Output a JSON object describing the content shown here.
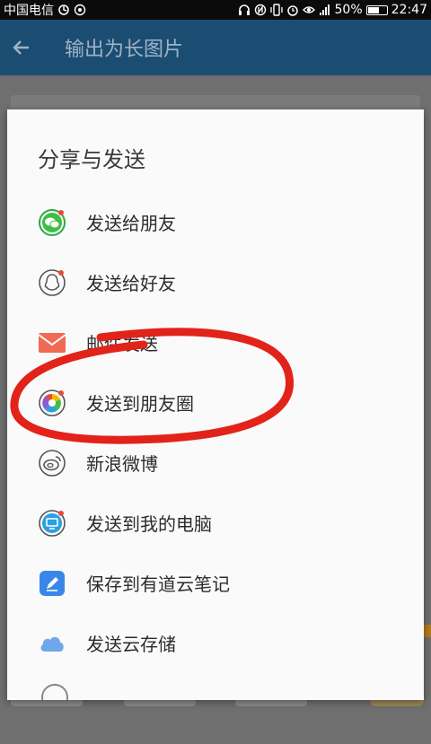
{
  "status_bar": {
    "carrier": "中国电信",
    "battery": "50%",
    "time": "22:47"
  },
  "app_bar": {
    "title": "输出为长图片",
    "back_icon": "arrow-left-icon"
  },
  "dialog": {
    "title": "分享与发送",
    "items": [
      {
        "label": "发送给朋友",
        "icon": "wechat-icon"
      },
      {
        "label": "发送给好友",
        "icon": "qq-icon"
      },
      {
        "label": "邮件发送",
        "icon": "mail-icon"
      },
      {
        "label": "发送到朋友圈",
        "icon": "moments-icon"
      },
      {
        "label": "新浪微博",
        "icon": "weibo-icon"
      },
      {
        "label": "发送到我的电脑",
        "icon": "computer-icon"
      },
      {
        "label": "保存到有道云笔记",
        "icon": "youdao-note-icon"
      },
      {
        "label": "发送云存储",
        "icon": "cloud-icon"
      }
    ]
  },
  "colors": {
    "status_bar": "#0b0b0b",
    "app_bar": "#1b4d73",
    "annotation": "#e2231a",
    "wechat": "#3fbf3f",
    "mail": "#f06a55",
    "computer": "#2aa0e0",
    "youdao": "#3a86e8",
    "cloud": "#6fa8e8"
  }
}
